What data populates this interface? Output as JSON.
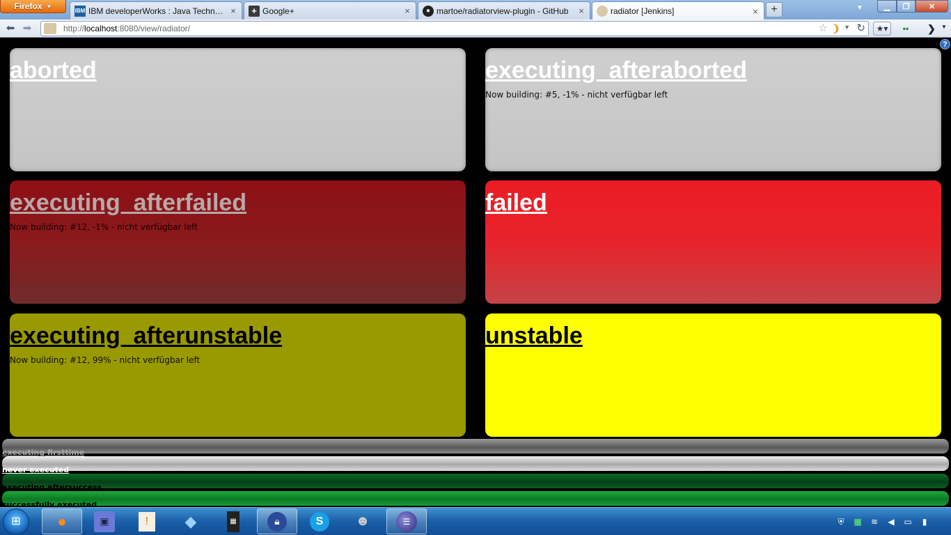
{
  "browser": {
    "app_button": "Firefox",
    "tabs": [
      {
        "label": "IBM developerWorks : Java Technolo...",
        "favicon": "IBM"
      },
      {
        "label": "Google+",
        "favicon": "+"
      },
      {
        "label": "martoe/radiatorview-plugin - GitHub",
        "favicon": "github"
      },
      {
        "label": "radiator [Jenkins]",
        "favicon": "jenkins",
        "active": true
      }
    ],
    "url": {
      "scheme": "http://",
      "host": "localhost",
      "rest": ":8080/view/radiator/"
    }
  },
  "radiator": {
    "help": "?",
    "jobs": [
      {
        "name": "aborted",
        "status": "aborted",
        "info": ""
      },
      {
        "name": "executing  afteraborted",
        "status": "aborted",
        "info": "Now building: #5, -1% - nicht verfügbar left"
      },
      {
        "name": "executing  afterfailed",
        "status": "execfailed",
        "info": "Now building: #12, -1% - nicht verfügbar left"
      },
      {
        "name": "failed",
        "status": "failed",
        "info": ""
      },
      {
        "name": "executing  afterunstable",
        "status": "execunstable",
        "info": "Now building: #12, 99% - nicht verfügbar left"
      },
      {
        "name": "unstable",
        "status": "unstable",
        "info": ""
      }
    ],
    "bar_jobs": [
      {
        "name": "executing  firsttime",
        "style": "grey-dark"
      },
      {
        "name": "never  executed",
        "style": "grey-light"
      },
      {
        "name": "executing  aftersuccess",
        "style": "green-dark"
      },
      {
        "name": "successfully  executed",
        "style": "green"
      }
    ]
  },
  "taskbar": {
    "items": [
      "firefox",
      "floppy-save",
      "notes",
      "dropbox",
      "calculator",
      "keepass",
      "skype",
      "jenkins-butler",
      "eclipse"
    ],
    "tray": [
      "network-shield",
      "grid",
      "wifi",
      "volume",
      "device",
      "battery"
    ]
  },
  "colors": {
    "aborted": "#c8c8c8",
    "execfailed": "#8a1a1c",
    "failed": "#e8232b",
    "execunstable": "#999900",
    "unstable": "#ffff00",
    "success": "#0c7a24"
  }
}
